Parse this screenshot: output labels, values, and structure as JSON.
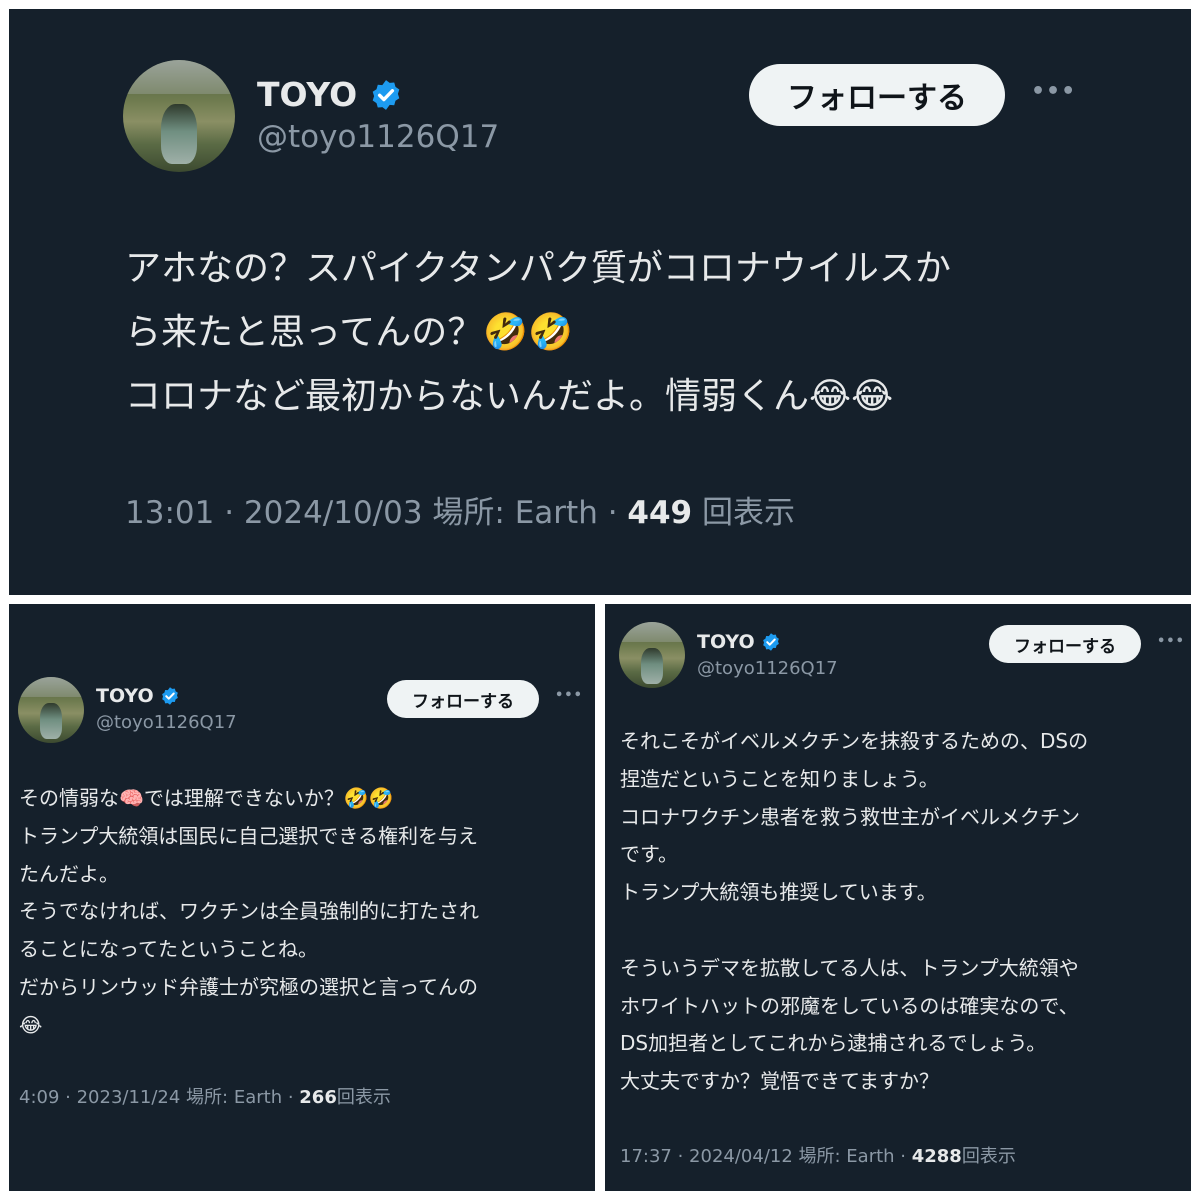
{
  "colors": {
    "background": "#15202b",
    "text": "#e7e9ea",
    "muted": "#8b98a5",
    "verified": "#1d9bf0",
    "follow_bg": "#eff3f4"
  },
  "tweet1": {
    "name": "TOYO",
    "handle": "@toyo1126Q17",
    "follow_label": "フォローする",
    "more_label": "•••",
    "lines": [
      "アホなの？スパイクタンパク質がコロナウイルスか",
      "ら来たと思ってんの？🤣🤣",
      "コロナなど最初からないんだよ。情弱くん😂😂"
    ],
    "meta_prefix": "13:01 · 2024/10/03 場所: Earth · ",
    "views": "449",
    "views_suffix": " 回表示"
  },
  "tweet2": {
    "name": "TOYO",
    "handle": "@toyo1126Q17",
    "follow_label": "フォローする",
    "more_label": "•••",
    "lines": [
      "その情弱な🧠では理解できないか？🤣🤣",
      "トランプ大統領は国民に自己選択できる権利を与え",
      "たんだよ。",
      "そうでなければ、ワクチンは全員強制的に打たされ",
      "ることになってたということね。",
      "だからリンウッド弁護士が究極の選択と言ってんの",
      "😂"
    ],
    "meta_prefix": "4:09 · 2023/11/24 場所: Earth · ",
    "views": "266",
    "views_suffix": "回表示"
  },
  "tweet3": {
    "name": "TOYO",
    "handle": "@toyo1126Q17",
    "follow_label": "フォローする",
    "more_label": "•••",
    "lines": [
      "それこそがイベルメクチンを抹殺するための、DSの",
      "捏造だということを知りましょう。",
      "コロナワクチン患者を救う救世主がイベルメクチン",
      "です。",
      "トランプ大統領も推奨しています。",
      "",
      "そういうデマを拡散してる人は、トランプ大統領や",
      "ホワイトハットの邪魔をしているのは確実なので、",
      "DS加担者としてこれから逮捕されるでしょう。",
      "大丈夫ですか？覚悟できてますか？"
    ],
    "meta_prefix": "17:37 · 2024/04/12 場所: Earth · ",
    "views": "4288",
    "views_suffix": "回表示"
  }
}
